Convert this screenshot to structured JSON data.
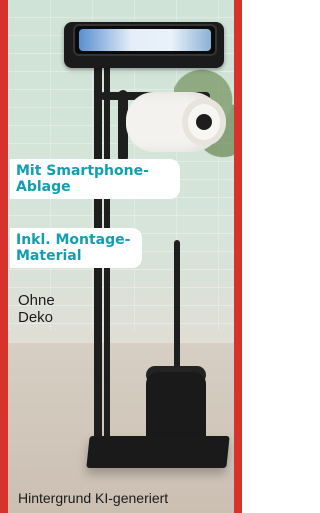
{
  "labels": {
    "feature_1": "Mit Smartphone-\nAblage",
    "feature_2": "Inkl. Montage-\nMaterial",
    "note": "Ohne\nDeko",
    "footer": "Hintergrund KI-generiert"
  },
  "colors": {
    "frame": "#d7332c",
    "badge_text": "#0f9fb0",
    "badge_bg": "#ffffff",
    "text": "#1b1b1b"
  }
}
